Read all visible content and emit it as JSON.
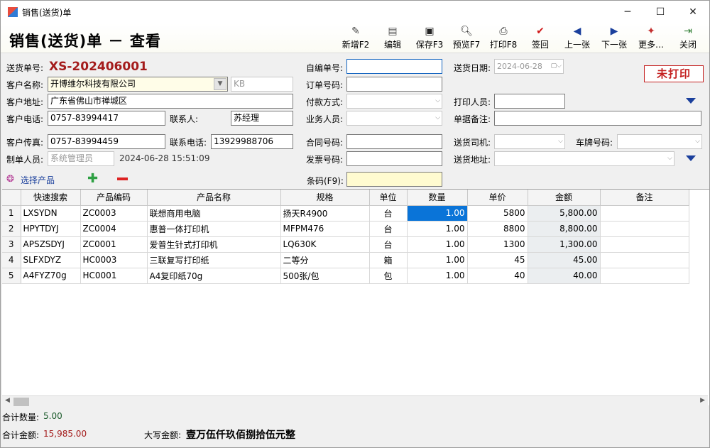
{
  "window": {
    "title": "销售(送货)单"
  },
  "header": {
    "title": "销售(送货)单 － 查看"
  },
  "toolbar": [
    {
      "label": "新增F2",
      "icon": "new-doc-icon"
    },
    {
      "label": "编辑",
      "icon": "edit-icon"
    },
    {
      "label": "保存F3",
      "icon": "save-icon"
    },
    {
      "label": "预览F7",
      "icon": "preview-icon"
    },
    {
      "label": "打印F8",
      "icon": "print-icon"
    },
    {
      "label": "签回",
      "icon": "check-icon"
    },
    {
      "label": "上一张",
      "icon": "prev-icon"
    },
    {
      "label": "下一张",
      "icon": "next-icon"
    },
    {
      "label": "更多…",
      "icon": "more-icon"
    },
    {
      "label": "关闭",
      "icon": "exit-icon"
    }
  ],
  "form": {
    "doc_no_label": "送货单号:",
    "doc_no": "XS-202406001",
    "status": "未打印",
    "customer_label": "客户名称:",
    "customer": "开博维尔科技有限公司",
    "customer_code": "KB",
    "address_label": "客户地址:",
    "address": "广东省佛山市禅城区",
    "phone_label": "客户电话:",
    "phone": "0757-83994417",
    "contact_label": "联系人:",
    "contact": "苏经理",
    "fax_label": "客户传真:",
    "fax": "0757-83994459",
    "contact_phone_label": "联系电话:",
    "contact_phone": "13929988706",
    "maker_label": "制单人员:",
    "maker": "系统管理员",
    "maker_time": "2024-06-28 15:51:09",
    "self_no_label": "自编单号:",
    "self_no": "",
    "order_no_label": "订单号码:",
    "order_no": "",
    "payment_label": "付款方式:",
    "payment": "",
    "sales_label": "业务人员:",
    "sales": "",
    "contract_label": "合同号码:",
    "contract": "",
    "invoice_label": "发票号码:",
    "invoice": "",
    "date_label": "送货日期:",
    "date": "2024-06-28",
    "printer_label": "打印人员:",
    "printer": "",
    "remark_label": "单据备注:",
    "remark": "",
    "driver_label": "送货司机:",
    "driver": "",
    "plate_label": "车牌号码:",
    "plate": "",
    "ship_addr_label": "送货地址:",
    "ship_addr": ""
  },
  "product_bar": {
    "select_label": "选择产品",
    "barcode_label": "条码(F9):",
    "barcode": ""
  },
  "grid": {
    "columns": [
      "快速搜索",
      "产品编码",
      "产品名称",
      "规格",
      "单位",
      "数量",
      "单价",
      "金额",
      "备注"
    ],
    "rows": [
      {
        "n": "1",
        "search": "LXSYDN",
        "code": "ZC0003",
        "name": "联想商用电脑",
        "spec": "扬天R4900",
        "unit": "台",
        "qty": "1.00",
        "price": "5800",
        "amount": "5,800.00",
        "remark": ""
      },
      {
        "n": "2",
        "search": "HPYTDYJ",
        "code": "ZC0004",
        "name": "惠普一体打印机",
        "spec": "MFPM476",
        "unit": "台",
        "qty": "1.00",
        "price": "8800",
        "amount": "8,800.00",
        "remark": ""
      },
      {
        "n": "3",
        "search": "APSZSDYJ",
        "code": "ZC0001",
        "name": "爱普生针式打印机",
        "spec": "LQ630K",
        "unit": "台",
        "qty": "1.00",
        "price": "1300",
        "amount": "1,300.00",
        "remark": ""
      },
      {
        "n": "4",
        "search": "SLFXDYZ",
        "code": "HC0003",
        "name": "三联复写打印纸",
        "spec": "二等分",
        "unit": "箱",
        "qty": "1.00",
        "price": "45",
        "amount": "45.00",
        "remark": ""
      },
      {
        "n": "5",
        "search": "A4FYZ70g",
        "code": "HC0001",
        "name": "A4复印纸70g",
        "spec": "500张/包",
        "unit": "包",
        "qty": "1.00",
        "price": "40",
        "amount": "40.00",
        "remark": ""
      }
    ]
  },
  "footer": {
    "total_qty_label": "合计数量:",
    "total_qty": "5.00",
    "total_amount_label": "合计金额:",
    "total_amount": "15,985.00",
    "caps_label": "大写金额:",
    "caps_amount": "壹万伍仟玖佰捌拾伍元整"
  },
  "colors": {
    "doc_no": "#a41c1c",
    "status": "#c42020",
    "selection": "#0a74d8"
  }
}
